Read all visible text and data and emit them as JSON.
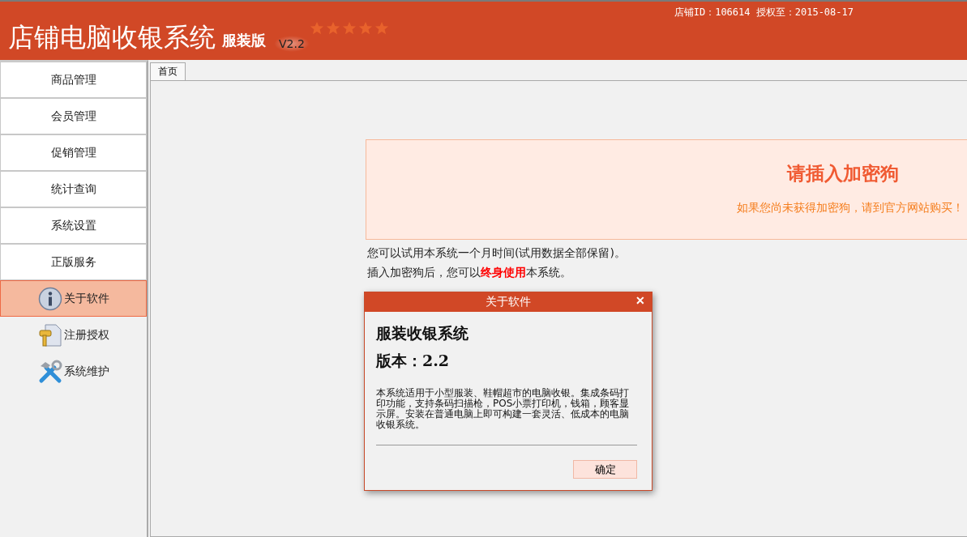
{
  "header": {
    "title": "店铺电脑收银系统",
    "edition": "服装版",
    "version": "V2.2",
    "stars": 5,
    "store_info": "店铺ID：106614 授权至：2015-08-17"
  },
  "sidebar": {
    "items": [
      {
        "kind": "button",
        "label": "商品管理",
        "selected": false
      },
      {
        "kind": "button",
        "label": "会员管理",
        "selected": false
      },
      {
        "kind": "button",
        "label": "促销管理",
        "selected": false
      },
      {
        "kind": "button",
        "label": "统计查询",
        "selected": false
      },
      {
        "kind": "button",
        "label": "系统设置",
        "selected": false
      },
      {
        "kind": "button",
        "label": "正版服务",
        "selected": false
      },
      {
        "kind": "info",
        "label": "关于软件",
        "selected": true
      },
      {
        "kind": "key",
        "label": "注册授权",
        "selected": false
      },
      {
        "kind": "tools",
        "label": "系统维护",
        "selected": false
      }
    ]
  },
  "tabs": [
    {
      "label": "首页",
      "selected": true
    }
  ],
  "notice": {
    "title": "请插入加密狗",
    "subtitle": "如果您尚未获得加密狗，请到官方网站购买！"
  },
  "trial_lines": [
    "您可以试用本系统一个月时间(试用数据全部保留)。",
    "插入加密狗后，您可以**终身使用**本系统。"
  ],
  "dialog": {
    "title": "关于软件",
    "close": "✕",
    "product": "服装收银系统",
    "version": "版本：2.2",
    "description": "本系统适用于小型服装、鞋帽超市的电脑收银。集成条码打印功能，支持条码扫描枪，POS小票打印机，钱箱，顾客显示屏。安装在普通电脑上即可构建一套灵活、低成本的电脑收银系统。",
    "ok": "确定"
  }
}
